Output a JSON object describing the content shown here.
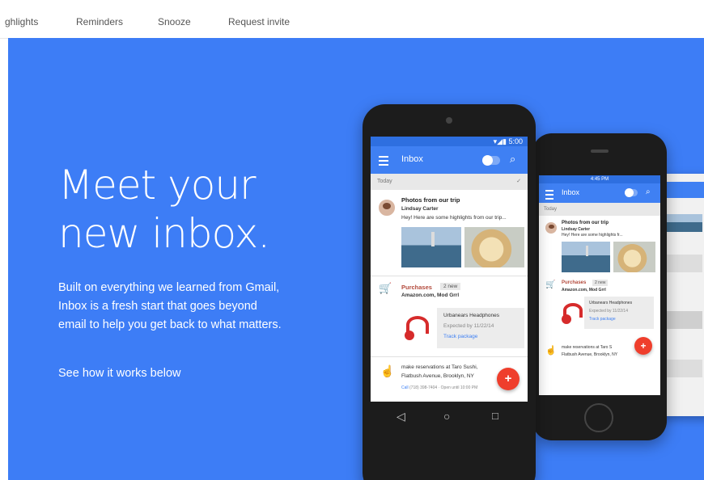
{
  "nav": {
    "items": [
      "ghlights",
      "Reminders",
      "Snooze",
      "Request invite"
    ]
  },
  "hero": {
    "title_line1": "Meet your",
    "title_line2": "new inbox.",
    "body": "Built on everything we learned from Gmail, Inbox is a fresh start that goes beyond email to help you get back to what matters.",
    "link": "See how it works below"
  },
  "phone_large": {
    "time": "5:00",
    "app_title": "Inbox",
    "section": "Today",
    "email1": {
      "title": "Photos from our trip",
      "sender": "Lindsay Carter",
      "preview": "Hey! Here are some highlights from our trip..."
    },
    "bundle": {
      "label": "Purchases",
      "badge": "2 new",
      "from": "Amazon.com, Mod Grrl"
    },
    "package": {
      "title": "Urbanears Headphones",
      "expected": "Expected by 11/22/14",
      "track": "Track package"
    },
    "reminder": {
      "line1": "make reservations at Taro Sushi,",
      "line2": "Flatbush Avenue, Brooklyn, NY",
      "call": "Call",
      "details": "(718) 398-7404 · Open until 10:00 PM"
    },
    "fab": "+"
  },
  "phone_small": {
    "time": "4:45 PM",
    "app_title": "Inbox",
    "section": "Today",
    "email1": {
      "title": "Photos from our trip",
      "sender": "Lindsay Carter",
      "preview": "Hey! Here are some highlights fr..."
    },
    "bundle": {
      "label": "Purchases",
      "badge": "2 new",
      "from": "Amazon.com, Mod Grrl"
    },
    "package": {
      "title": "Urbanears Headphones",
      "expected": "Expected by 11/22/14",
      "track": "Track package"
    },
    "reminder": {
      "line1": "make reservations at Taro S",
      "line2": "Flatbush Avenue, Brooklyn, NY"
    },
    "fab": "+"
  },
  "colors": {
    "hero_bg": "#3d7df6",
    "app_bar": "#3f80f3",
    "fab": "#ef3e2c"
  }
}
